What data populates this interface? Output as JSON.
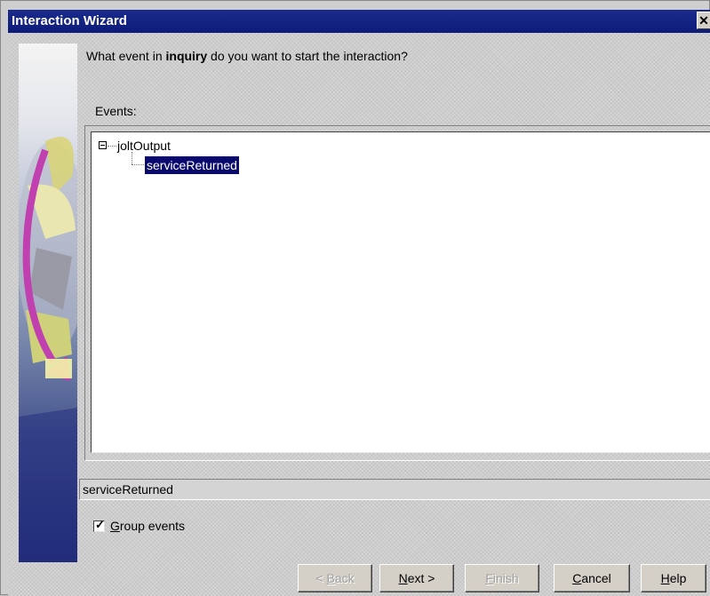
{
  "window": {
    "title": "Interaction Wizard",
    "close_glyph": "✕"
  },
  "prompt": {
    "prefix": "What event in ",
    "component": "inquiry",
    "suffix": " do you want to start the interaction?"
  },
  "events": {
    "label": "Events:",
    "tree": {
      "root": {
        "label": "joltOutput",
        "expanded": true,
        "children": [
          {
            "label": "serviceReturned",
            "selected": true
          }
        ]
      }
    }
  },
  "selected_event_field": {
    "value": "serviceReturned"
  },
  "group_events": {
    "checked": true,
    "label_accel": "G",
    "label_rest": "roup events"
  },
  "buttons": {
    "back": {
      "label_prefix": "< ",
      "accel": "B",
      "rest": "ack",
      "enabled": false
    },
    "next": {
      "accel": "N",
      "rest": "ext >",
      "enabled": true
    },
    "finish": {
      "accel": "F",
      "rest": "inish",
      "enabled": false
    },
    "cancel": {
      "accel": "C",
      "rest": "ancel",
      "enabled": true
    },
    "help": {
      "accel": "H",
      "rest": "elp",
      "enabled": true
    }
  },
  "colors": {
    "title_bar": "#0d1c78",
    "selection": "#0a0a6e",
    "dialog_bg": "#cfcfcf"
  }
}
